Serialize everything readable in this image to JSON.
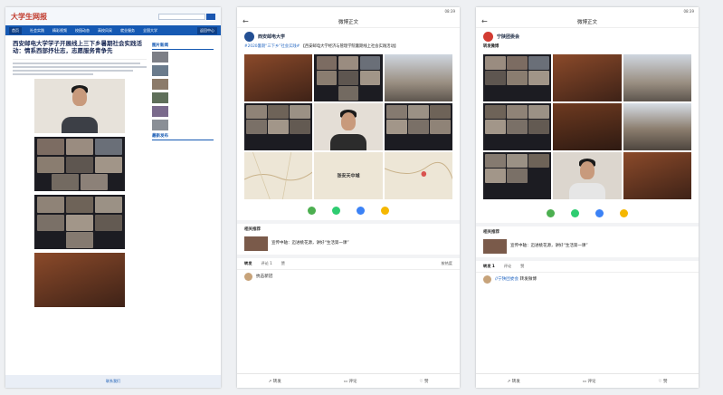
{
  "panel1": {
    "logo_main": "大学生网报",
    "logo_sub": "",
    "search_placeholder": "",
    "nav": [
      "首页",
      "社会实践",
      "精彩视频",
      "校园动态",
      "高校风采",
      "就业服务",
      "全国大学"
    ],
    "nav_right": "返回中心",
    "crumb": "",
    "title": "西安邮电大学学子开展线上三下乡暑期社会实践活动：情系西部抒壮志，志愿服务青争先",
    "meta": "",
    "captions": [
      "",
      "",
      "",
      ""
    ],
    "sidebar_title_1": "图片新闻",
    "sidebar_items": [
      "",
      "",
      "",
      "",
      "",
      ""
    ],
    "sidebar_title_2": "最新发布",
    "sidebar_links": [
      "",
      "",
      "",
      "",
      "",
      "",
      "",
      "",
      "",
      ""
    ],
    "footer": "联系我们"
  },
  "app": {
    "status_time": "08:39",
    "title": "微博正文",
    "back_icon": "←"
  },
  "post1": {
    "author": "西安邮电大学",
    "time": "",
    "source_tag": "",
    "follow": "",
    "text": "【西安邮电大学经济与管理学院暑期线上社会实践活动】",
    "text_tag": "#2020暑期“三下乡”社会实践#",
    "photo_watermark": "",
    "map_label": "张安天中城",
    "recommend_section": "相关推荐",
    "recommend_text": "宣传中轴：迈进桃花源，讲好“生活第一课”",
    "tabs": [
      "转发",
      "评论",
      "赞"
    ],
    "counts": [
      "",
      "1",
      ""
    ],
    "hot": "按热度",
    "comment_name": "",
    "comment_time": "",
    "comment_text": "抗击新冠",
    "bottom": [
      "转发",
      "评论",
      "赞"
    ]
  },
  "post2": {
    "author": "宁陕团委会",
    "time": "",
    "follow": "",
    "repost_label": "转发微博",
    "text": "",
    "text_tag": "",
    "stats": [
      "",
      "",
      ""
    ],
    "recommend_section": "相关推荐",
    "recommend_text": "宣传中轴：迈进桃花源，讲好“生活第一课”",
    "tabs": [
      "转发",
      "评论",
      "赞"
    ],
    "counts": [
      "1",
      "",
      ""
    ],
    "comment_name": "",
    "comment_time": "",
    "comment_tag": "//宁陕团委会",
    "comment_text": "转发微博",
    "bottom": [
      "转发",
      "评论",
      "赞"
    ]
  },
  "colors": {
    "nav_blue": "#1559b3",
    "link_blue": "#2b6cc4",
    "accent_orange": "#e08a1c"
  }
}
